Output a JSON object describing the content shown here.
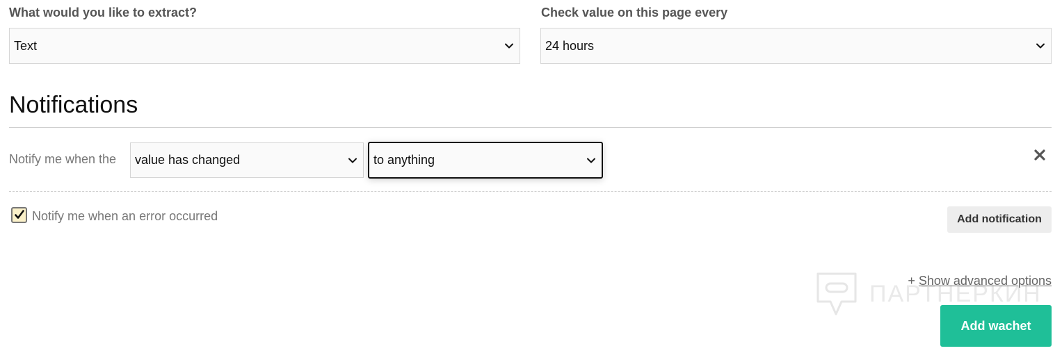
{
  "extract": {
    "label": "What would you like to extract?",
    "value": "Text"
  },
  "frequency": {
    "label": "Check value on this page every",
    "value": "24 hours"
  },
  "notifications": {
    "title": "Notifications",
    "rule_prefix": "Notify me when the",
    "condition_value": "value has changed",
    "target_value": "to anything",
    "error_checkbox_label": "Notify me when an error occurred",
    "error_checkbox_checked": true,
    "add_button": "Add notification"
  },
  "footer": {
    "advanced_prefix": "+ ",
    "advanced_link": "Show advanced options",
    "submit_button": "Add wachet"
  },
  "watermark": "ПАРТНЕРКИН",
  "colors": {
    "primary_button": "#1fbf98",
    "checkbox_fill": "#fbf1c9"
  },
  "icons": {
    "select_arrow": "chevron-down-icon",
    "remove": "close-icon",
    "checkbox": "check-icon"
  }
}
